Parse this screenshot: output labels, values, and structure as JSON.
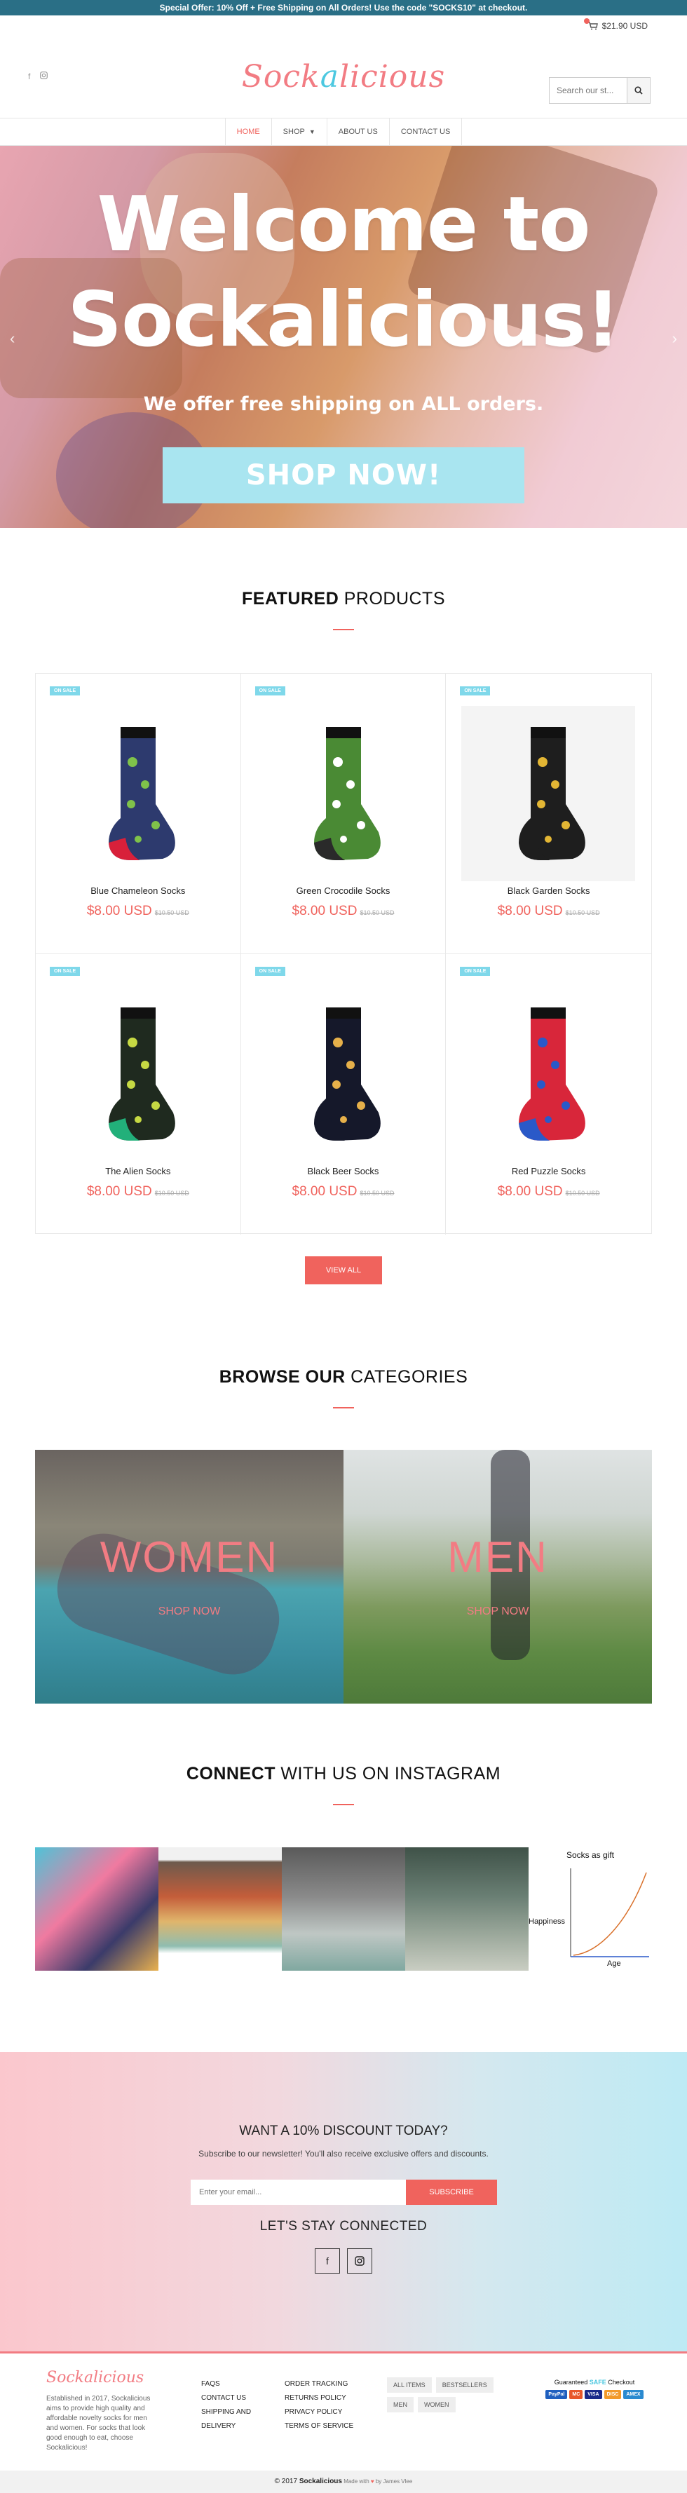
{
  "announcement": "Special Offer: 10% Off + Free Shipping on All Orders! Use the code \"SOCKS10\" at checkout.",
  "cart": {
    "total": "$21.90 USD",
    "icon": "cart-icon"
  },
  "header": {
    "logo_pre": "Sock",
    "logo_a": "a",
    "logo_post": "licious",
    "search_placeholder": "Search our st...",
    "social_icons": [
      "facebook-icon",
      "instagram-icon"
    ]
  },
  "nav": {
    "home": "HOME",
    "shop": "SHOP",
    "about": "ABOUT US",
    "contact": "CONTACT US"
  },
  "hero": {
    "title_line1": "Welcome to",
    "title_line2": "Sockalicious!",
    "subtitle": "We offer free shipping on ALL orders.",
    "button": "SHOP NOW!"
  },
  "featured": {
    "title_bold": "FEATURED",
    "title_rest": " PRODUCTS"
  },
  "sale_label": "ON SALE",
  "products": [
    {
      "name": "Blue Chameleon Socks",
      "price": "$8.00 USD",
      "was": "$10.50 USD",
      "sock": "#2d3a6e",
      "accent": "#7fc24a",
      "heel": "#d8203a"
    },
    {
      "name": "Green Crocodile Socks",
      "price": "$8.00 USD",
      "was": "$10.50 USD",
      "sock": "#4a8a34",
      "accent": "#ffffff",
      "heel": "#2a2a2a"
    },
    {
      "name": "Black Garden Socks",
      "price": "$8.00 USD",
      "was": "$10.50 USD",
      "sock": "#1e1e1e",
      "accent": "#e3b634",
      "heel": "#1e1e1e"
    },
    {
      "name": "The Alien Socks",
      "price": "$8.00 USD",
      "was": "$10.50 USD",
      "sock": "#1f2a1f",
      "accent": "#c6d943",
      "heel": "#22b07a"
    },
    {
      "name": "Black Beer Socks",
      "price": "$8.00 USD",
      "was": "$10.50 USD",
      "sock": "#15182a",
      "accent": "#e6b04a",
      "heel": "#15182a"
    },
    {
      "name": "Red Puzzle Socks",
      "price": "$8.00 USD",
      "was": "$10.50 USD",
      "sock": "#d8263a",
      "accent": "#2a59c8",
      "heel": "#2a59c8"
    }
  ],
  "view_all": "VIEW ALL",
  "browse": {
    "title_bold": "BROWSE OUR",
    "title_rest": " CATEGORIES"
  },
  "categories": [
    {
      "label": "WOMEN",
      "shop": "SHOP NOW"
    },
    {
      "label": "MEN",
      "shop": "SHOP NOW"
    }
  ],
  "instagram": {
    "title_bold": "CONNECT",
    "title_rest": " WITH US ON INSTAGRAM",
    "graph_title": "Socks as gift",
    "graph_y": "Happiness",
    "graph_x": "Age"
  },
  "newsletter": {
    "title": "WANT A 10% DISCOUNT TODAY?",
    "subtitle": "Subscribe to our newsletter! You'll also receive exclusive offers and discounts.",
    "placeholder": "Enter your email...",
    "button": "SUBSCRIBE",
    "connect": "LET'S STAY CONNECTED"
  },
  "footer": {
    "logo": "Sockalicious",
    "about": "Established in 2017, Sockalicious aims to provide high quality and affordable novelty socks for men and women. For socks that look good enough to eat, choose Sockalicious!",
    "col1": [
      "FAQS",
      "CONTACT US",
      "SHIPPING AND DELIVERY"
    ],
    "col2": [
      "ORDER TRACKING",
      "RETURNS POLICY",
      "PRIVACY POLICY",
      "TERMS OF SERVICE"
    ],
    "tags": [
      "ALL ITEMS",
      "BESTSELLERS",
      "MEN",
      "WOMEN"
    ],
    "guaranteed_pre": "Guaranteed ",
    "guaranteed_safe": "SAFE",
    "guaranteed_post": " Checkout",
    "cards": [
      "PayPal",
      "MC",
      "VISA",
      "DISC",
      "AMEX"
    ]
  },
  "copyright": {
    "pre": "© 2017 ",
    "brand": "Sockalicious",
    "made": " Made with ",
    "heart": "♥",
    "by": " by James Vlee"
  },
  "colors": {
    "accent": "#f0635d",
    "logo": "#f27c83",
    "teal": "#4cc8e0",
    "announce": "#2a6f86"
  }
}
